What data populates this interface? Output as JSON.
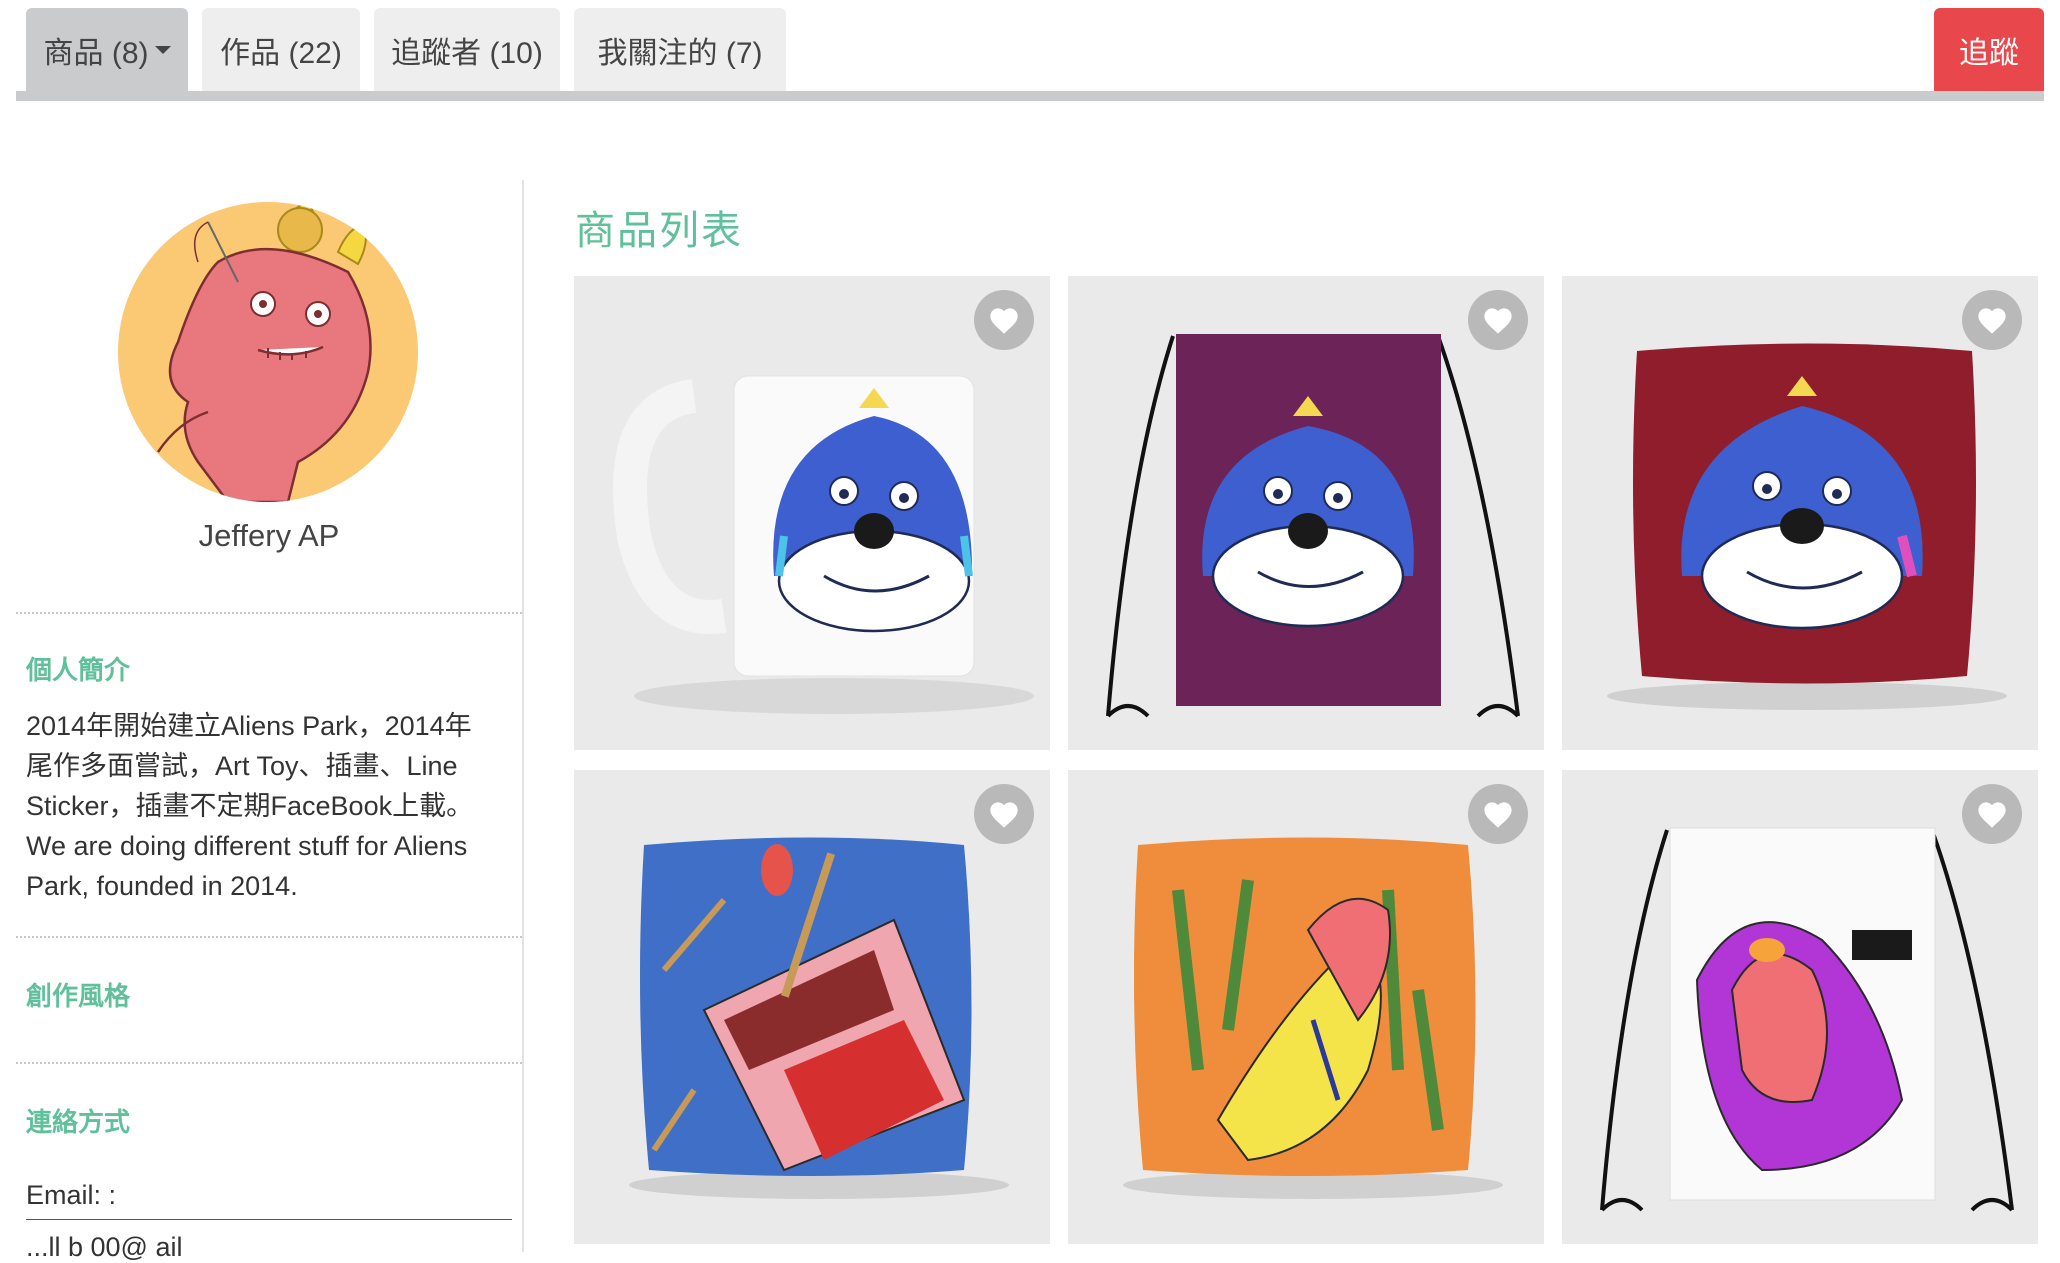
{
  "tabs": [
    {
      "label": "商品 (8)",
      "active": true,
      "has_dropdown": true
    },
    {
      "label": "作品 (22)",
      "active": false
    },
    {
      "label": "追蹤者 (10)",
      "active": false
    },
    {
      "label": "我關注的 (7)",
      "active": false
    }
  ],
  "follow_button": {
    "label": "追蹤",
    "color": "#e8474b"
  },
  "profile": {
    "name": "Jeffery AP",
    "bio_title": "個人簡介",
    "bio_lines": [
      "2014年開始建立Aliens Park，2014年",
      "尾作多面嘗試，Art Toy、插畫、Line",
      "Sticker，插畫不定期FaceBook上載。",
      "We are doing different stuff for Aliens",
      "Park, founded in 2014."
    ],
    "style_title": "創作風格",
    "contact_title": "連絡方式",
    "email_label": "Email: :",
    "email_value_partial": "...ll  b 00@  ail"
  },
  "main": {
    "title": "商品列表",
    "products": [
      {
        "type": "mug",
        "icon": "heart-icon"
      },
      {
        "type": "drawstring-bag-purple",
        "icon": "heart-icon"
      },
      {
        "type": "pillow-red",
        "icon": "heart-icon"
      },
      {
        "type": "pillow-blue-matches",
        "icon": "heart-icon"
      },
      {
        "type": "pillow-orange",
        "icon": "heart-icon"
      },
      {
        "type": "drawstring-bag-white",
        "icon": "heart-icon"
      }
    ]
  },
  "colors": {
    "accent_green": "#5fc09b",
    "follow_red": "#e8474b",
    "tab_active": "#c9cbcc",
    "tab_inactive": "#eeeeee"
  }
}
